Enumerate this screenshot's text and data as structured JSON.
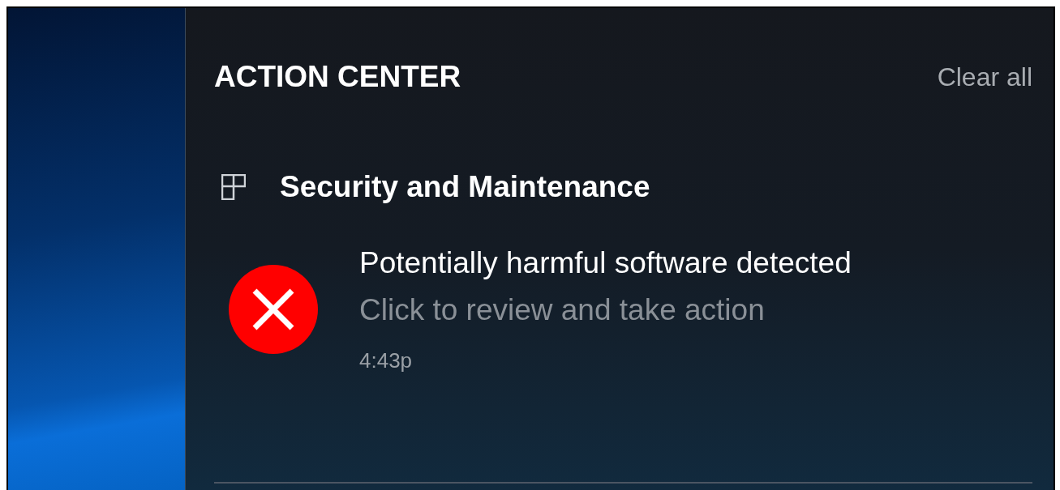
{
  "panel": {
    "title": "ACTION CENTER",
    "clear_all": "Clear all"
  },
  "groups": [
    {
      "name": "Security and Maintenance",
      "notifications": [
        {
          "kind": "error",
          "title": "Potentially harmful software detected",
          "body": "Click to review and take action",
          "time": "4:43p"
        }
      ]
    }
  ]
}
